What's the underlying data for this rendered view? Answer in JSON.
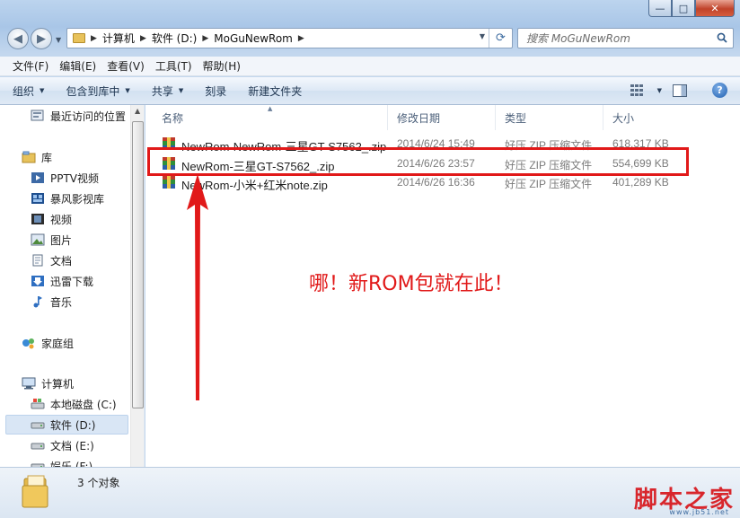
{
  "window": {
    "caption": {
      "minimize": "—",
      "maximize": "□",
      "close": "✕"
    }
  },
  "address_bar": {
    "crumbs": [
      "计算机",
      "软件 (D:)",
      "MoGuNewRom"
    ],
    "search_placeholder": "搜索 MoGuNewRom"
  },
  "menubar": {
    "items": [
      "文件(F)",
      "编辑(E)",
      "查看(V)",
      "工具(T)",
      "帮助(H)"
    ]
  },
  "toolbar": {
    "organize": "组织",
    "include_in_library": "包含到库中",
    "share": "共享",
    "burn": "刻录",
    "new_folder": "新建文件夹"
  },
  "nav": {
    "recent": "最近访问的位置",
    "libraries": "库",
    "library_items": [
      "PPTV视频",
      "暴风影视库",
      "视频",
      "图片",
      "文档",
      "迅雷下载",
      "音乐"
    ],
    "homegroup": "家庭组",
    "computer": "计算机",
    "drives": [
      "本地磁盘 (C:)",
      "软件 (D:)",
      "文档 (E:)",
      "娱乐 (F:)"
    ],
    "selected": "软件 (D:)"
  },
  "columns": {
    "name": "名称",
    "modified": "修改日期",
    "type": "类型",
    "size": "大小"
  },
  "files": [
    {
      "name": "NewRom-NewRom-三星GT-S7562_.zip",
      "modified": "2014/6/24 15:49",
      "type": "好压 ZIP 压缩文件",
      "size": "618,317 KB"
    },
    {
      "name": "NewRom-三星GT-S7562_.zip",
      "modified": "2014/6/26 23:57",
      "type": "好压 ZIP 压缩文件",
      "size": "554,699 KB"
    },
    {
      "name": "NewRom-小米+红米note.zip",
      "modified": "2014/6/26 16:36",
      "type": "好压 ZIP 压缩文件",
      "size": "401,289 KB"
    }
  ],
  "annotation": "哪！新ROM包就在此！",
  "details": {
    "count": "3 个对象"
  },
  "watermark": {
    "logo": "脚本之家",
    "url": "www.jb51.net"
  },
  "colors": {
    "highlight": "#e11919",
    "accent": "#3f6da1"
  }
}
